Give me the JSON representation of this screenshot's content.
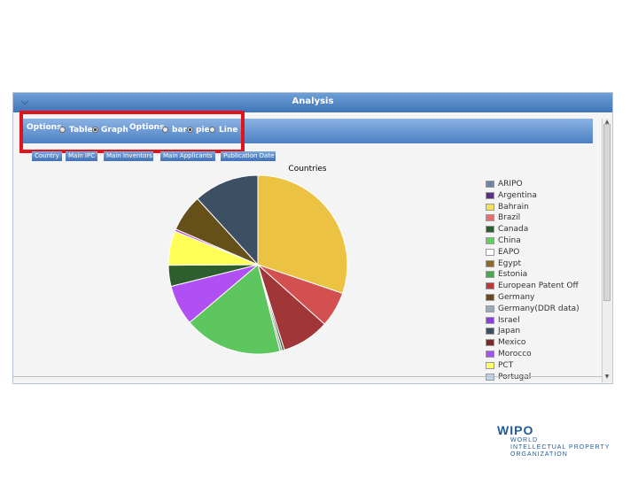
{
  "window": {
    "title": "Analysis",
    "collapse_icon": "chevron-down-icon"
  },
  "options_bar": {
    "view_label": "Options",
    "view_options": [
      {
        "label": "Table",
        "selected": false
      },
      {
        "label": "Graph",
        "selected": true
      }
    ],
    "graph_label": "Options",
    "graph_options": [
      {
        "label": "bar",
        "selected": false
      },
      {
        "label": "pie",
        "selected": true
      },
      {
        "label": "Line",
        "selected": false
      }
    ]
  },
  "toolbar_buttons": [
    "Country",
    "Main IPC",
    "Main Inventors",
    "Main Applicants",
    "Publication Date"
  ],
  "accent_color": "#4d80c4",
  "highlight_color": "#e0141c",
  "chart_data": {
    "type": "pie",
    "title": "Countries",
    "legend": "right",
    "slices": [
      {
        "name": "ARIPO",
        "value": 0,
        "color": "#6f85a0"
      },
      {
        "name": "Argentina",
        "value": 0,
        "color": "#5b2f86"
      },
      {
        "name": "Bahrain",
        "value": 0,
        "color": "#f4e35a"
      },
      {
        "name": "Brazil",
        "value": 0,
        "color": "#e66f6f"
      },
      {
        "name": "Canada",
        "value": 0,
        "color": "#2f5e2e"
      },
      {
        "name": "China",
        "value": 0,
        "color": "#66cc66"
      },
      {
        "name": "EAPO",
        "value": 0,
        "color": "#ffffff"
      },
      {
        "name": "Egypt",
        "value": 0,
        "color": "#8a6a2f"
      },
      {
        "name": "Estonia",
        "value": 0,
        "color": "#4aa84a"
      },
      {
        "name": "European Patent Off",
        "value": 0,
        "color": "#b33b3b"
      },
      {
        "name": "Germany",
        "value": 0,
        "color": "#6b4a20"
      },
      {
        "name": "Germany(DDR data)",
        "value": 0,
        "color": "#9aaabb"
      },
      {
        "name": "Israel",
        "value": 0,
        "color": "#8a3fd6"
      },
      {
        "name": "Japan",
        "value": 0,
        "color": "#3d4f63"
      },
      {
        "name": "Mexico",
        "value": 0,
        "color": "#7a2a2a"
      },
      {
        "name": "Morocco",
        "value": 0,
        "color": "#a64ff0"
      },
      {
        "name": "PCT",
        "value": 0,
        "color": "#ffff66"
      },
      {
        "name": "Portugal",
        "value": 0,
        "color": "#bcd4ee"
      }
    ],
    "pie_slices": [
      {
        "value": 30.2,
        "color": "#ecc242"
      },
      {
        "value": 6.4,
        "color": "#d25050"
      },
      {
        "value": 8.6,
        "color": "#a13638"
      },
      {
        "value": 0.4,
        "color": "#2f5e2e"
      },
      {
        "value": 0.4,
        "color": "#9aa0a6"
      },
      {
        "value": 17.8,
        "color": "#5ec65e"
      },
      {
        "value": 7.3,
        "color": "#b04ff2"
      },
      {
        "value": 3.8,
        "color": "#2f5e2e"
      },
      {
        "value": 6.2,
        "color": "#ffff55"
      },
      {
        "value": 0.4,
        "color": "#bb44cc"
      },
      {
        "value": 6.7,
        "color": "#66501a"
      },
      {
        "value": 11.8,
        "color": "#3d4f63"
      }
    ]
  },
  "logo": {
    "name": "WIPO",
    "lines": [
      "WORLD",
      "INTELLECTUAL PROPERTY",
      "ORGANIZATION"
    ]
  }
}
